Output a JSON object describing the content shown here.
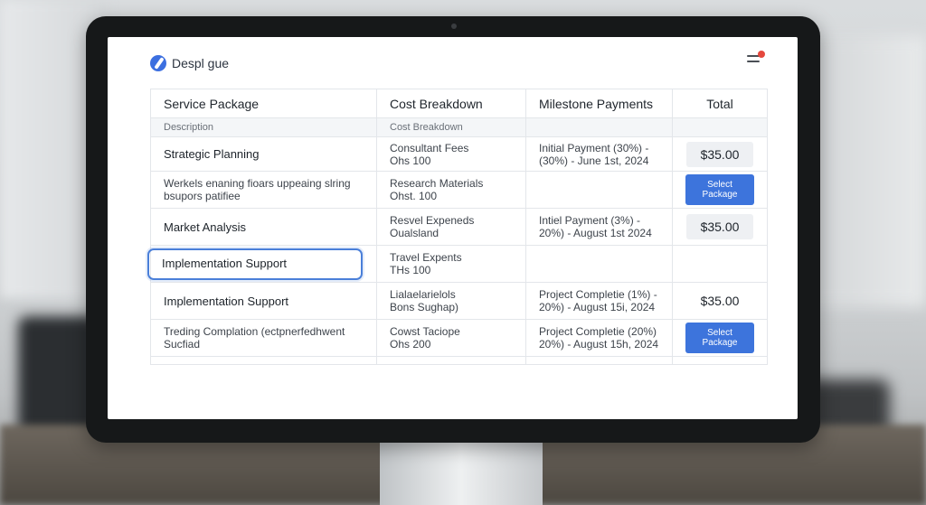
{
  "app": {
    "title": "Despl gue"
  },
  "table": {
    "headers": [
      "Service Package",
      "Cost Breakdown",
      "Milestone Payments",
      "Total"
    ],
    "subheader": {
      "description": "Description",
      "cost": "Cost Breakdown"
    },
    "rows": [
      {
        "package": "Strategic Planning",
        "cost1": "Consultant Fees",
        "cost2": "Ohs 100",
        "milestone1": "Initial Payment (30%) -",
        "milestone2": "(30%) - June 1st, 2024",
        "total": "$35.00"
      },
      {
        "package1": "Werkels enaning fioars uppeaing slring",
        "package2": "bsupors patifiee",
        "cost1": "Research Materials",
        "cost2": "Ohst. 100",
        "button": "Select Package"
      },
      {
        "package": "Market Analysis",
        "cost1": "Resvel Expeneds",
        "cost2": "Oualsland",
        "milestone1": "Intiel Payment (3%) -",
        "milestone2": "20%) - August 1st 2024",
        "total": "$35.00"
      },
      {
        "package": "Implementation Support",
        "cost1": "Travel Expents",
        "cost2": "THs 100"
      },
      {
        "package": "Implementation Support",
        "cost1": "Lialaelarielols",
        "cost2": "Bons Sughap)",
        "milestone1": "Project Completie (1%) -",
        "milestone2": "20%) - August 15i, 2024",
        "total": "$35.00"
      },
      {
        "package1": "Treding Complation (ectpnerfedhwent",
        "package2": "Sucfiad",
        "cost1": "Cowst Taciope",
        "cost2": "Ohs 200",
        "milestone1": "Project Completie (20%)",
        "milestone2": "20%) - August 15h, 2024",
        "button": "Select Package"
      }
    ]
  },
  "colors": {
    "accent": "#3d74dc",
    "notification": "#e5483d"
  }
}
